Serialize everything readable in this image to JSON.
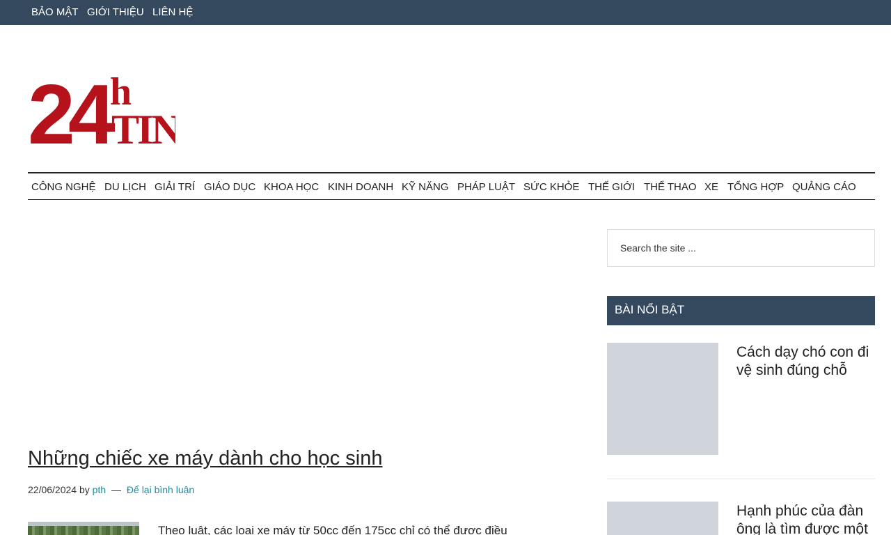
{
  "topbar": {
    "links": [
      "BẢO MẬT",
      "GIỚI THIỆU",
      "LIÊN HỆ"
    ]
  },
  "logo": {
    "big": "24",
    "small": "h",
    "word": "TIN",
    "color": "#b5121b"
  },
  "nav": {
    "items": [
      "CÔNG NGHỆ",
      "DU LỊCH",
      "GIẢI TRÍ",
      "GIÁO DỤC",
      "KHOA HỌC",
      "KINH DOANH",
      "KỸ NĂNG",
      "PHÁP LUẬT",
      "SỨC KHỎE",
      "THẾ GIỚI",
      "THỂ THAO",
      "XE",
      "TỔNG HỢP",
      "QUẢNG CÁO"
    ]
  },
  "post": {
    "title": "Những chiếc xe máy dành cho học sinh",
    "date": "22/06/2024",
    "by": "by",
    "author": "pth",
    "separator": "—",
    "comments": "Để lại bình luận",
    "excerpt": "Theo luật, các loại xe máy từ 50cc đến 175cc chỉ có thể được điều"
  },
  "sidebar": {
    "search_placeholder": "Search the site ...",
    "featured_title": "BÀI NỔI BẬT",
    "featured": [
      {
        "title": "Cách dạy chó con đi vệ sinh đúng chỗ"
      },
      {
        "title": "Hạnh phúc của đàn ông là tìm được một"
      }
    ]
  },
  "colors": {
    "topbar_bg": "#34495e",
    "accent_link": "#1a8fa0",
    "placeholder_thumb": "#d0d5dc"
  }
}
